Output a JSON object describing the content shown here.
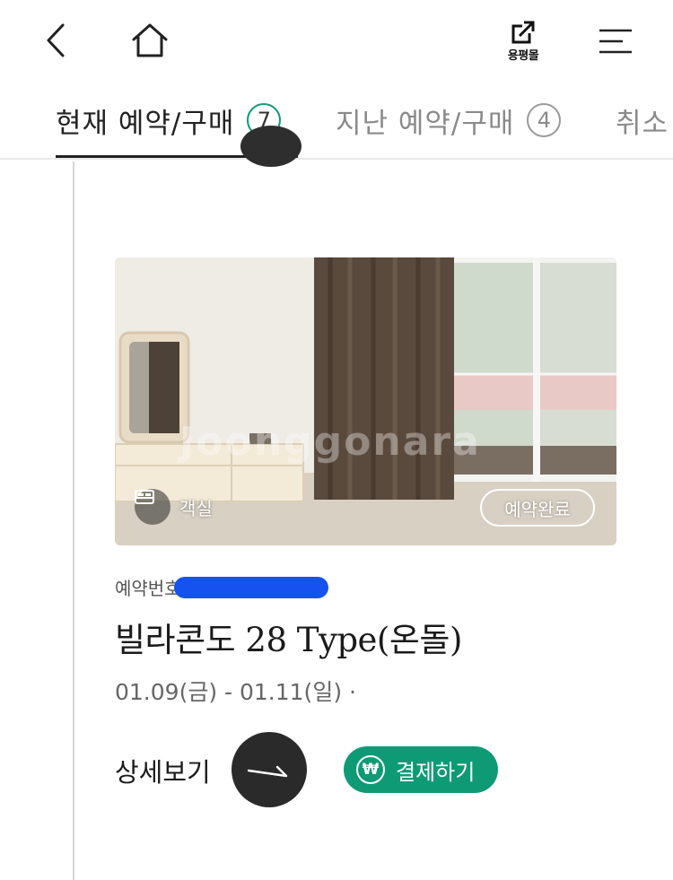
{
  "header": {
    "back_icon": "chevron-left-icon",
    "home_icon": "home-icon",
    "mall_label": "용평몰",
    "mall_icon": "external-link-icon",
    "menu_icon": "menu-icon"
  },
  "tabs": [
    {
      "label": "현재 예약/구매",
      "count": "7",
      "active": true
    },
    {
      "label": "지난 예약/구매",
      "count": "4",
      "active": false
    },
    {
      "label": "취소",
      "active": false
    }
  ],
  "card": {
    "room_type_label": "객실",
    "room_type_icon": "bed-icon",
    "status_badge": "예약완료",
    "watermark": "Joonggonara",
    "reservation_number_label": "예약번호",
    "room_title": "빌라콘도 28 Type(온돌)",
    "stay_dates": "01.09(금) - 01.11(일) ·",
    "detail_label": "상세보기",
    "pay_label": "결제하기",
    "pay_icon_symbol": "₩"
  },
  "colors": {
    "accent_green": "#0f9a76",
    "redaction_blue": "#1652f0",
    "dark_button": "#2a2a2a"
  }
}
